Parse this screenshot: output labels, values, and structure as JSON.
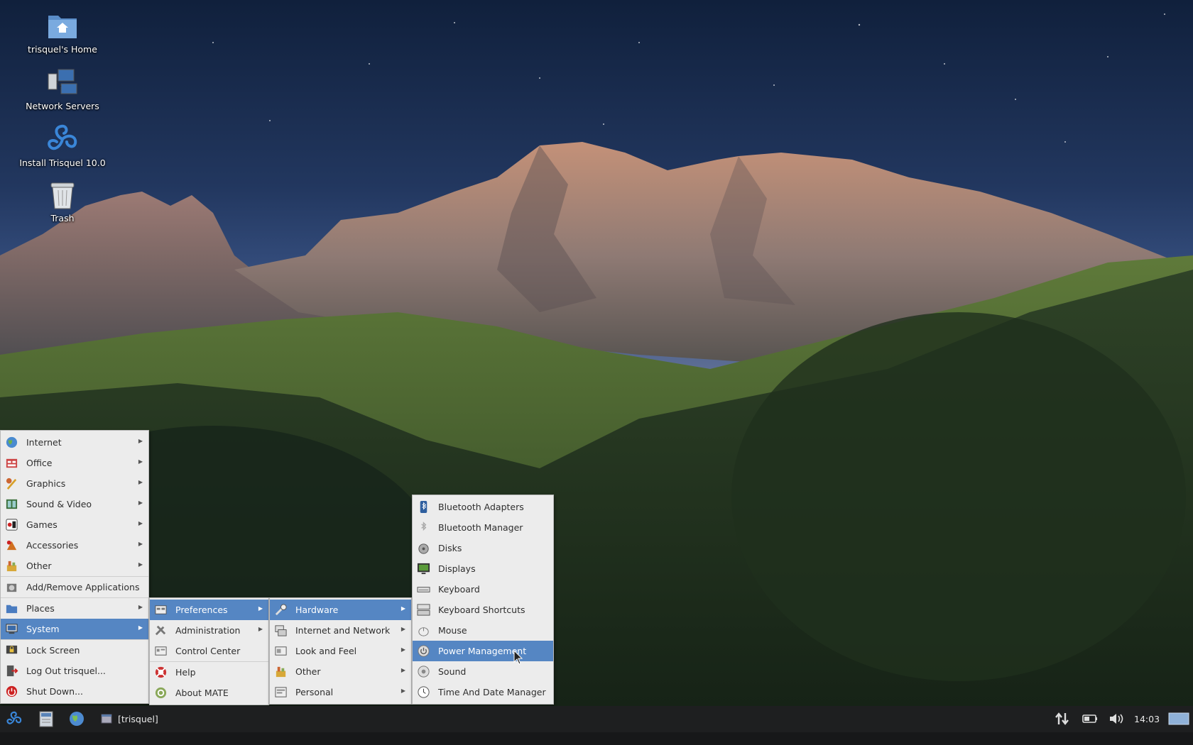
{
  "desktop": {
    "icons": [
      {
        "label": "trisquel's Home",
        "icon": "home-folder-icon"
      },
      {
        "label": "Network Servers",
        "icon": "network-servers-icon"
      },
      {
        "label": "Install Trisquel 10.0",
        "icon": "trisquel-install-icon"
      },
      {
        "label": "Trash",
        "icon": "trash-icon"
      }
    ]
  },
  "menu_main": {
    "items": [
      {
        "label": "Internet",
        "icon": "globe-icon",
        "submenu": true
      },
      {
        "label": "Office",
        "icon": "office-icon",
        "submenu": true
      },
      {
        "label": "Graphics",
        "icon": "graphics-icon",
        "submenu": true
      },
      {
        "label": "Sound & Video",
        "icon": "sound-video-icon",
        "submenu": true
      },
      {
        "label": "Games",
        "icon": "games-icon",
        "submenu": true
      },
      {
        "label": "Accessories",
        "icon": "accessories-icon",
        "submenu": true
      },
      {
        "label": "Other",
        "icon": "other-icon",
        "submenu": true
      },
      {
        "label": "Add/Remove Applications",
        "icon": "package-icon",
        "submenu": false
      },
      {
        "label": "Places",
        "icon": "folder-icon",
        "submenu": true
      },
      {
        "label": "System",
        "icon": "computer-icon",
        "submenu": true,
        "active": true
      },
      {
        "label": "Lock Screen",
        "icon": "lock-screen-icon",
        "submenu": false
      },
      {
        "label": "Log Out trisquel...",
        "icon": "logout-icon",
        "submenu": false
      },
      {
        "label": "Shut Down...",
        "icon": "shutdown-icon",
        "submenu": false
      }
    ]
  },
  "menu_system": {
    "items": [
      {
        "label": "Preferences",
        "icon": "preferences-icon",
        "submenu": true,
        "active": true
      },
      {
        "label": "Administration",
        "icon": "administration-icon",
        "submenu": true
      },
      {
        "label": "Control Center",
        "icon": "control-center-icon",
        "submenu": false
      },
      {
        "label": "Help",
        "icon": "help-icon",
        "submenu": false
      },
      {
        "label": "About MATE",
        "icon": "about-icon",
        "submenu": false
      }
    ]
  },
  "menu_preferences": {
    "items": [
      {
        "label": "Hardware",
        "icon": "hardware-icon",
        "submenu": true,
        "active": true
      },
      {
        "label": "Internet and Network",
        "icon": "network-icon",
        "submenu": true
      },
      {
        "label": "Look and Feel",
        "icon": "look-feel-icon",
        "submenu": true
      },
      {
        "label": "Other",
        "icon": "other-icon",
        "submenu": true
      },
      {
        "label": "Personal",
        "icon": "personal-icon",
        "submenu": true
      }
    ]
  },
  "menu_hardware": {
    "items": [
      {
        "label": "Bluetooth Adapters",
        "icon": "bluetooth-icon"
      },
      {
        "label": "Bluetooth Manager",
        "icon": "bluetooth-manager-icon"
      },
      {
        "label": "Disks",
        "icon": "disks-icon"
      },
      {
        "label": "Displays",
        "icon": "displays-icon"
      },
      {
        "label": "Keyboard",
        "icon": "keyboard-icon"
      },
      {
        "label": "Keyboard Shortcuts",
        "icon": "keyboard-shortcuts-icon"
      },
      {
        "label": "Mouse",
        "icon": "mouse-icon"
      },
      {
        "label": "Power Management",
        "icon": "power-management-icon",
        "active": true
      },
      {
        "label": "Sound",
        "icon": "sound-icon"
      },
      {
        "label": "Time And Date Manager",
        "icon": "clock-icon"
      }
    ]
  },
  "panel": {
    "task_label": "[trisquel]",
    "clock": "14:03"
  },
  "colors": {
    "menu_bg": "#ececec",
    "highlight": "#5586c3",
    "panel_bg": "#1e1f20"
  }
}
